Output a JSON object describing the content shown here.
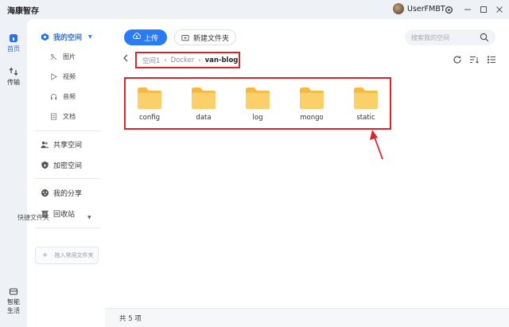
{
  "app": {
    "title": "海康智存"
  },
  "user": {
    "name": "UserFMBT"
  },
  "rail": {
    "home_label": "首页",
    "transfer_label": "传输",
    "smart_label_1": "智能",
    "smart_label_2": "生活"
  },
  "sidebar": {
    "my_space": "我的空间",
    "sub": {
      "pictures": "图片",
      "videos": "视频",
      "audio": "音频",
      "docs": "文档"
    },
    "shared": "共享空间",
    "encrypted": "加密空间",
    "my_share": "我的分享",
    "recycle": "回收站",
    "quick_folder": "快捷文件夹",
    "pin_placeholder": "拖入常用文件夹"
  },
  "toolbar": {
    "upload_label": "上传",
    "new_folder_label": "新建文件夹",
    "search_placeholder": "搜索我的空间"
  },
  "breadcrumb": {
    "root": "空间1",
    "middle": "Docker",
    "current": "van-blog"
  },
  "folders": [
    "config",
    "data",
    "log",
    "mongo",
    "static"
  ],
  "footer": {
    "count_text": "共 5 项"
  },
  "colors": {
    "accent": "#2a7cf5",
    "highlight": "#d9262b",
    "folder": "#f7c95c"
  }
}
